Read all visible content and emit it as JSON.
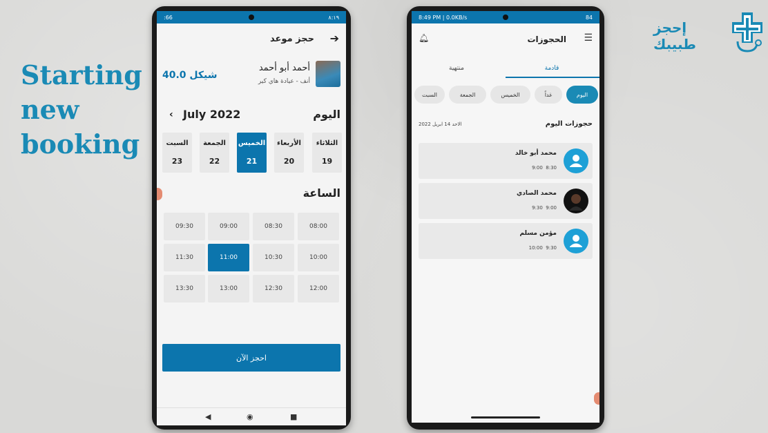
{
  "promo": {
    "line1": "Starting",
    "line2": "new",
    "line3": "booking"
  },
  "brand": {
    "name": "إحجز طبيبك",
    "accent": "#1a8ab5"
  },
  "left_phone": {
    "status": {
      "left": ":66",
      "right": "٨:١٩"
    },
    "appbar_title": "حجز موعد",
    "price": "40.0 شيكل",
    "doctor": {
      "name": "أحمد أبو أحمد",
      "subtitle": "أنف - عيادة هاي كير"
    },
    "today_label": "اليوم",
    "month_label": "July 2022",
    "days": [
      {
        "name": "الثلاثاء",
        "date": "19",
        "selected": false
      },
      {
        "name": "الأربعاء",
        "date": "20",
        "selected": false
      },
      {
        "name": "الخميس",
        "date": "21",
        "selected": true
      },
      {
        "name": "الجمعة",
        "date": "22",
        "selected": false
      },
      {
        "name": "السبت",
        "date": "23",
        "selected": false
      }
    ],
    "hour_label": "الساعة",
    "slots": [
      [
        "09:30",
        "09:00",
        "08:30",
        "08:00"
      ],
      [
        "11:30",
        "11:00",
        "10:30",
        "10:00"
      ],
      [
        "13:30",
        "13:00",
        "12:30",
        "12:00"
      ]
    ],
    "selected_slot": "11:00",
    "book_button": "احجز الآن",
    "primary_color": "#0c75ad"
  },
  "right_phone": {
    "status": {
      "left": "8:49 PM | 0.0KB/s",
      "right": "84"
    },
    "title": "الحجوزات",
    "tabs": [
      "منتهية",
      "قادمة"
    ],
    "active_tab": "قادمة",
    "chips": [
      "السبت",
      "الجمعة",
      "الخميس",
      "غداً",
      "اليوم"
    ],
    "active_chip": "اليوم",
    "section_title": "حجوزات اليوم",
    "date": "الاحد 14 ابريل 2022",
    "bookings": [
      {
        "name": "محمد أبو خالد",
        "from": "8:30",
        "to": "9:00",
        "avatar": "default"
      },
      {
        "name": "محمد الصادي",
        "from": "9:00",
        "to": "9:30",
        "avatar": "photo"
      },
      {
        "name": "مؤمن مسلم",
        "from": "9:30",
        "to": "10:00",
        "avatar": "default"
      }
    ]
  }
}
